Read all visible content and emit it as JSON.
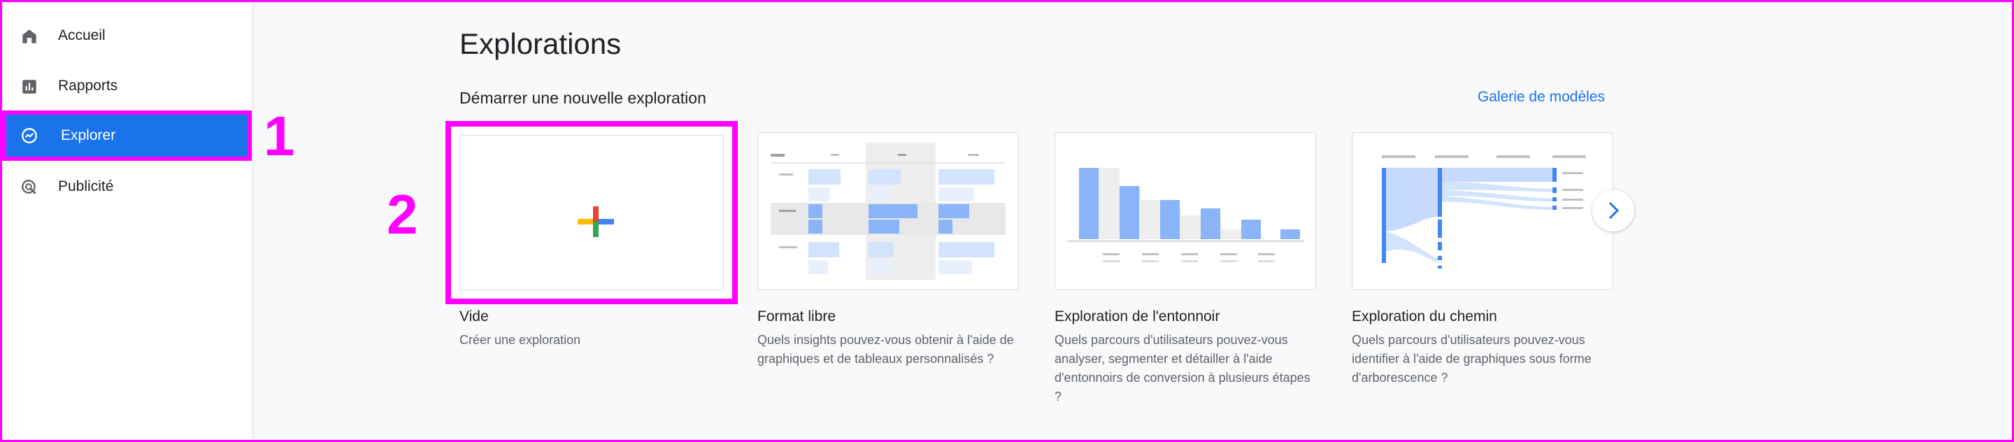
{
  "sidebar": {
    "items": [
      {
        "label": "Accueil",
        "icon": "home-icon"
      },
      {
        "label": "Rapports",
        "icon": "bar-chart-icon"
      },
      {
        "label": "Explorer",
        "icon": "explore-icon",
        "active": true
      },
      {
        "label": "Publicité",
        "icon": "advertising-icon"
      }
    ]
  },
  "callouts": {
    "one": "1",
    "two": "2"
  },
  "main": {
    "title": "Explorations",
    "subtitle": "Démarrer une nouvelle exploration",
    "gallery_link": "Galerie de modèles",
    "cards": [
      {
        "title": "Vide",
        "description": "Créer une exploration"
      },
      {
        "title": "Format libre",
        "description": "Quels insights pouvez-vous obtenir à l'aide de graphiques et de tableaux personnalisés ?"
      },
      {
        "title": "Exploration de l'entonnoir",
        "description": "Quels parcours d'utilisateurs pouvez-vous analyser, segmenter et détailler à l'aide d'entonnoirs de conversion à plusieurs étapes ?"
      },
      {
        "title": "Exploration du chemin",
        "description": "Quels parcours d'utilisateurs pouvez-vous identifier à l'aide de graphiques sous forme d'arborescence ?"
      }
    ]
  },
  "colors": {
    "accent": "#1a73e8",
    "highlight": "#ff00ff",
    "chart_blue": "#8ab4f8"
  }
}
